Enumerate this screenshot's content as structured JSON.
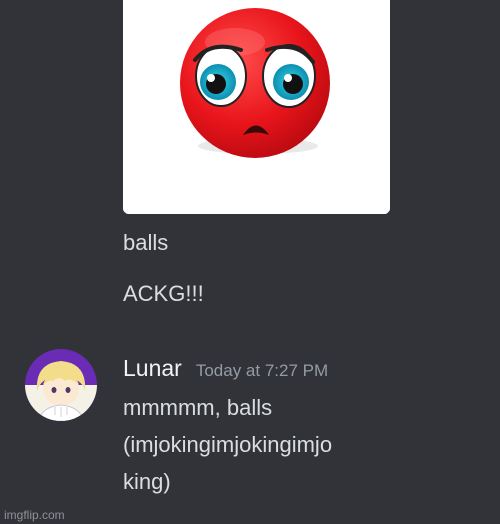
{
  "earlier_message": {
    "attachment": {
      "icon": "crying-red-face-icon",
      "face_color": "#e8151b"
    },
    "lines": [
      "balls",
      "ACKG!!!"
    ]
  },
  "message": {
    "author": "Lunar",
    "timestamp": "Today at 7:27 PM",
    "body_lines": [
      "mmmmm, balls",
      "(imjokingimjokingimjo",
      "king)"
    ]
  },
  "watermark": "imgflip.com",
  "colors": {
    "background": "#313338",
    "text": "#dbdee1",
    "author": "#f2f3f5",
    "timestamp": "#949ba4"
  }
}
